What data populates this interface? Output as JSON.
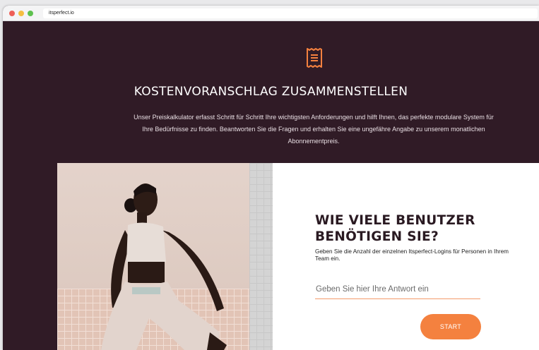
{
  "browser": {
    "url": "itsperfect.io"
  },
  "hero": {
    "icon": "receipt-icon",
    "title": "KOSTENVORANSCHLAG ZUSAMMENSTELLEN",
    "description": "Unser Preiskalkulator erfasst Schritt für Schritt Ihre wichtigsten Anforderungen und hilft Ihnen, das perfekte modulare System für Ihre Bedürfnisse zu finden. Beantworten Sie die Fragen und erhalten Sie eine ungefähre Angabe zu unserem monatlichen Abonnementpreis."
  },
  "question": {
    "title": "WIE VIELE BENUTZER BENÖTIGEN SIE?",
    "description": "Geben Sie die Anzahl der einzelnen Itsperfect-Logins für Personen in Ihrem Team ein.",
    "input_placeholder": "Geben Sie hier Ihre Antwort ein",
    "input_value": "",
    "start_label": "START"
  },
  "colors": {
    "background": "#301b26",
    "accent": "#f4813f",
    "card": "#ffffff"
  }
}
